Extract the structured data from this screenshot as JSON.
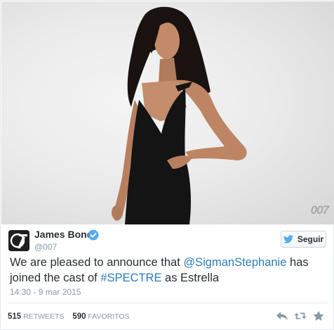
{
  "tweet": {
    "photo_watermark": "007",
    "user": {
      "name": "James Bond",
      "screen_name": "@007",
      "verified": true,
      "avatar_icon": "007-logo-icon"
    },
    "follow_label": "Seguir",
    "text": {
      "part1": "We are pleased to announce that ",
      "mention": "@SigmanStephanie",
      "part2": " has joined the cast of ",
      "hashtag": "#SPECTRE",
      "part3": " as Estrella"
    },
    "timestamp": "14:30 - 9 mar 2015",
    "stats": {
      "retweets_count": "515",
      "retweets_label": "RETWEETS",
      "favorites_count": "590",
      "favorites_label": "FAVORITOS"
    },
    "actions": [
      "reply-icon",
      "retweet-icon",
      "favorite-icon"
    ],
    "colors": {
      "link": "#2b7bb9",
      "verified": "#55acee",
      "muted": "#8899a6",
      "text": "#292f33",
      "action_icon": "#8899a6"
    }
  }
}
